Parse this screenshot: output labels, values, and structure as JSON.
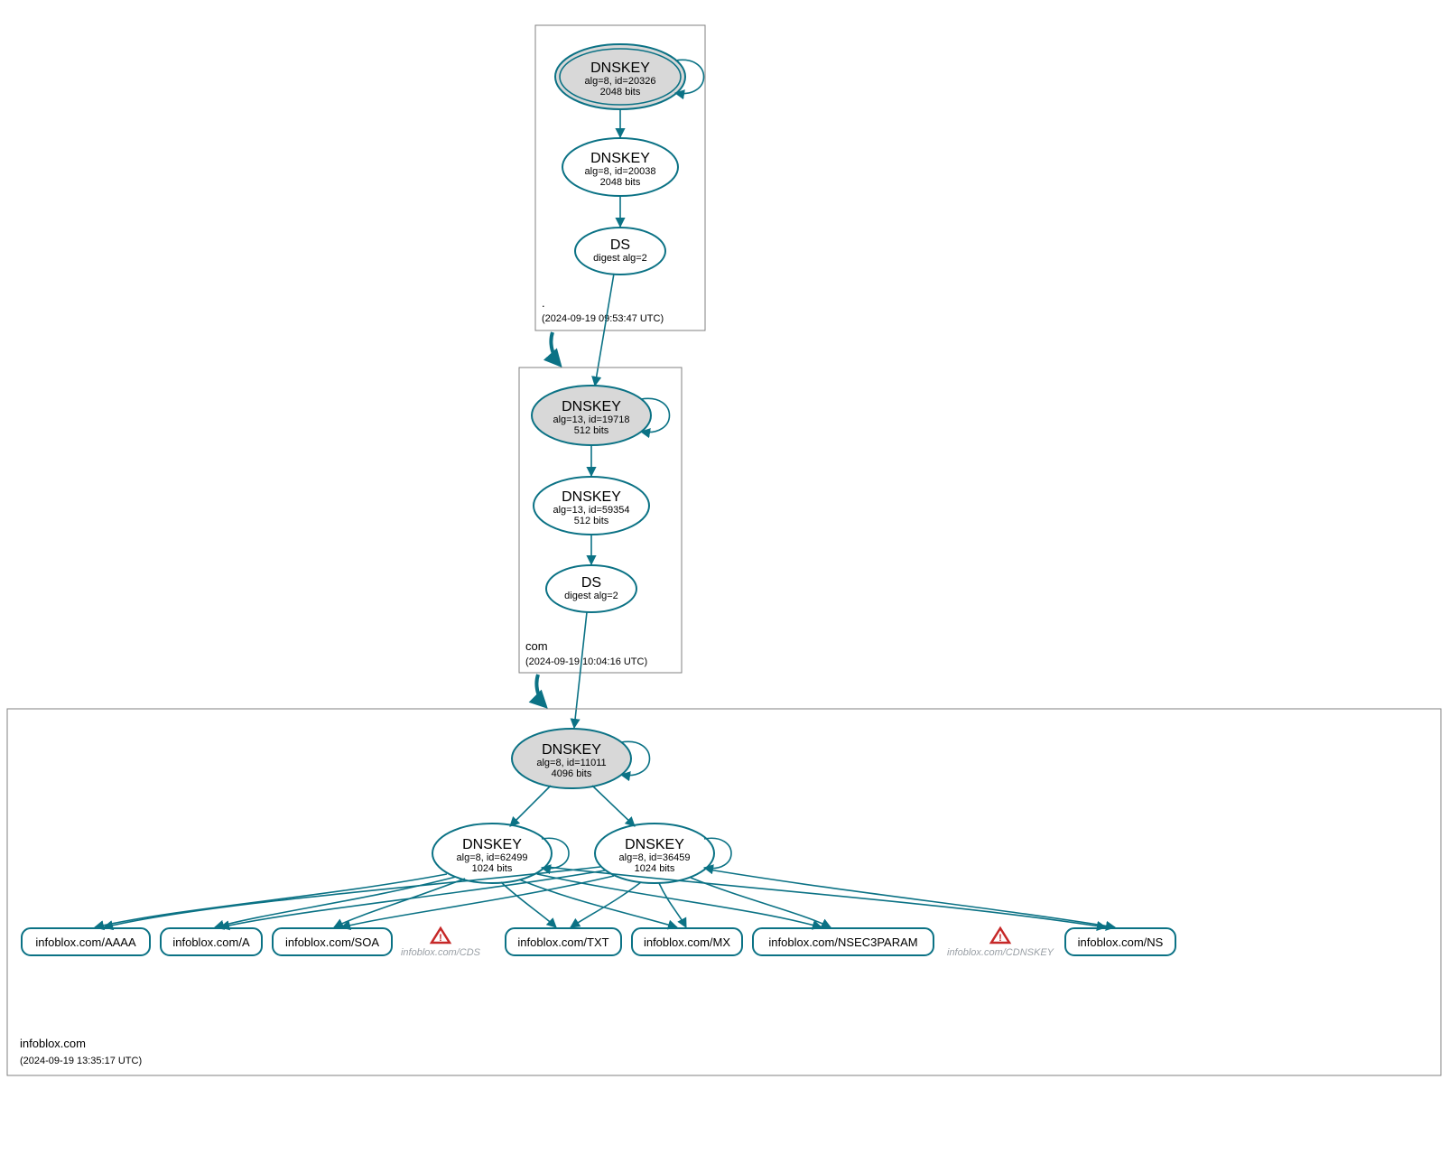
{
  "colors": {
    "teal": "#0b7285",
    "fillGrey": "#d8d8d8",
    "white": "#ffffff",
    "boxStroke": "#808080",
    "warnRed": "#c62828",
    "warnGrey": "#9aa0a6"
  },
  "zones": {
    "root": {
      "label": ".",
      "timestamp": "(2024-09-19 09:53:47 UTC)",
      "nodes": {
        "ksk": {
          "title": "DNSKEY",
          "sub1": "alg=8, id=20326",
          "sub2": "2048 bits"
        },
        "zsk": {
          "title": "DNSKEY",
          "sub1": "alg=8, id=20038",
          "sub2": "2048 bits"
        },
        "ds": {
          "title": "DS",
          "sub1": "digest alg=2",
          "sub2": ""
        }
      }
    },
    "com": {
      "label": "com",
      "timestamp": "(2024-09-19 10:04:16 UTC)",
      "nodes": {
        "ksk": {
          "title": "DNSKEY",
          "sub1": "alg=13, id=19718",
          "sub2": "512 bits"
        },
        "zsk": {
          "title": "DNSKEY",
          "sub1": "alg=13, id=59354",
          "sub2": "512 bits"
        },
        "ds": {
          "title": "DS",
          "sub1": "digest alg=2",
          "sub2": ""
        }
      }
    },
    "domain": {
      "label": "infoblox.com",
      "timestamp": "(2024-09-19 13:35:17 UTC)",
      "nodes": {
        "ksk": {
          "title": "DNSKEY",
          "sub1": "alg=8, id=11011",
          "sub2": "4096 bits"
        },
        "zsk1": {
          "title": "DNSKEY",
          "sub1": "alg=8, id=62499",
          "sub2": "1024 bits"
        },
        "zsk2": {
          "title": "DNSKEY",
          "sub1": "alg=8, id=36459",
          "sub2": "1024 bits"
        }
      },
      "rrsets": {
        "aaaa": "infoblox.com/AAAA",
        "a": "infoblox.com/A",
        "soa": "infoblox.com/SOA",
        "txt": "infoblox.com/TXT",
        "mx": "infoblox.com/MX",
        "nsec3param": "infoblox.com/NSEC3PARAM",
        "ns": "infoblox.com/NS"
      },
      "warnings": {
        "cds": "infoblox.com/CDS",
        "cdnskey": "infoblox.com/CDNSKEY"
      }
    }
  }
}
